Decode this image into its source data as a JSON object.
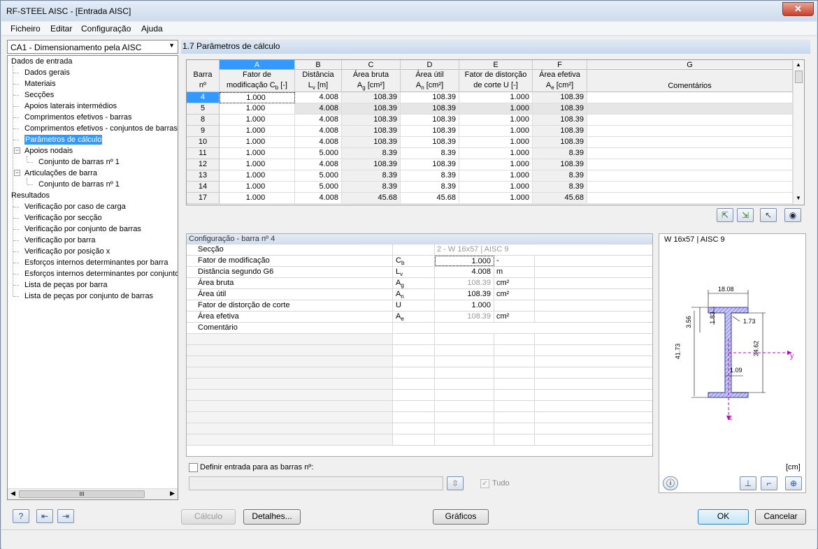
{
  "window": {
    "title": "RF-STEEL AISC - [Entrada AISC]",
    "close": "✕"
  },
  "menu": [
    "Ficheiro",
    "Editar",
    "Configuração",
    "Ajuda"
  ],
  "case_select": "CA1 - Dimensionamento pela AISC",
  "tree": {
    "input_root": "Dados de entrada",
    "input_items": [
      "Dados gerais",
      "Materiais",
      "Secções",
      "Apoios laterais intermédios",
      "Comprimentos efetivos - barras",
      "Comprimentos efetivos - conjuntos de barras",
      "Parâmetros de cálculo",
      "Apoios nodais",
      "Conjunto de barras nº 1",
      "Articulações de barra",
      "Conjunto de barras nº 1"
    ],
    "results_root": "Resultados",
    "results_items": [
      "Verificação por caso de carga",
      "Verificação por secção",
      "Verificação por conjunto de barras",
      "Verificação por barra",
      "Verificação por posição x",
      "Esforços internos determinantes por barra",
      "Esforços internos determinantes por conjunto",
      "Lista de peças por barra",
      "Lista de peças por conjunto de barras"
    ]
  },
  "panel_title": "1.7 Parâmetros de cálculo",
  "grid": {
    "col_letters": [
      "A",
      "B",
      "C",
      "D",
      "E",
      "F",
      "G"
    ],
    "row_header": {
      "l1": "Barra",
      "l2": "nº"
    },
    "headers": [
      {
        "l1": "Fator de",
        "l2": "modificação C",
        "sub": "b",
        "tail": " [-]"
      },
      {
        "l1": "Distância",
        "l2": "L",
        "sub": "v",
        "tail": " [m]"
      },
      {
        "l1": "Área bruta",
        "l2": "A",
        "sub": "g",
        "tail": " [cm²]"
      },
      {
        "l1": "Área útil",
        "l2": "A",
        "sub": "n",
        "tail": " [cm²]"
      },
      {
        "l1": "Fator de distorção",
        "l2": "de corte U",
        "sub": "",
        "tail": " [-]"
      },
      {
        "l1": "Área efetiva",
        "l2": "A",
        "sub": "e",
        "tail": " [cm²]"
      },
      {
        "l1": "",
        "l2": "Comentários",
        "sub": "",
        "tail": ""
      }
    ],
    "rows": [
      {
        "n": "4",
        "a": "1.000",
        "b": "4.008",
        "c": "108.39",
        "d": "108.39",
        "e": "1.000",
        "f": "108.39"
      },
      {
        "n": "5",
        "a": "1.000",
        "b": "4.008",
        "c": "108.39",
        "d": "108.39",
        "e": "1.000",
        "f": "108.39"
      },
      {
        "n": "8",
        "a": "1.000",
        "b": "4.008",
        "c": "108.39",
        "d": "108.39",
        "e": "1.000",
        "f": "108.39"
      },
      {
        "n": "9",
        "a": "1.000",
        "b": "4.008",
        "c": "108.39",
        "d": "108.39",
        "e": "1.000",
        "f": "108.39"
      },
      {
        "n": "10",
        "a": "1.000",
        "b": "4.008",
        "c": "108.39",
        "d": "108.39",
        "e": "1.000",
        "f": "108.39"
      },
      {
        "n": "11",
        "a": "1.000",
        "b": "5.000",
        "c": "8.39",
        "d": "8.39",
        "e": "1.000",
        "f": "8.39"
      },
      {
        "n": "12",
        "a": "1.000",
        "b": "4.008",
        "c": "108.39",
        "d": "108.39",
        "e": "1.000",
        "f": "108.39"
      },
      {
        "n": "13",
        "a": "1.000",
        "b": "5.000",
        "c": "8.39",
        "d": "8.39",
        "e": "1.000",
        "f": "8.39"
      },
      {
        "n": "14",
        "a": "1.000",
        "b": "5.000",
        "c": "8.39",
        "d": "8.39",
        "e": "1.000",
        "f": "8.39"
      },
      {
        "n": "17",
        "a": "1.000",
        "b": "4.008",
        "c": "45.68",
        "d": "45.68",
        "e": "1.000",
        "f": "45.68"
      }
    ]
  },
  "config": {
    "title": "Configuração - barra nº 4",
    "rows": [
      {
        "label": "Secção",
        "sym": "",
        "sub": "",
        "val": "2 - W 16x57 | AISC 9",
        "unit": ""
      },
      {
        "label": "Fator de modificação",
        "sym": "C",
        "sub": "b",
        "val": "1.000",
        "unit": "-"
      },
      {
        "label": "Distância segundo G6",
        "sym": "L",
        "sub": "v",
        "val": "4.008",
        "unit": "m"
      },
      {
        "label": "Área bruta",
        "sym": "A",
        "sub": "g",
        "val": "108.39",
        "unit": "cm²"
      },
      {
        "label": "Área útil",
        "sym": "A",
        "sub": "n",
        "val": "108.39",
        "unit": "cm²"
      },
      {
        "label": "Fator de distorção de corte",
        "sym": "U",
        "sub": "",
        "val": "1.000",
        "unit": ""
      },
      {
        "label": "Área efetiva",
        "sym": "A",
        "sub": "e",
        "val": "108.39",
        "unit": "cm²"
      },
      {
        "label": "Comentário",
        "sym": "",
        "sub": "",
        "val": "",
        "unit": ""
      }
    ],
    "set_for_label": "Definir entrada para as barras nº:",
    "all_label": "Tudo"
  },
  "section_view": {
    "title": "W 16x57 | AISC 9",
    "unit": "[cm]",
    "dims": {
      "b": "18.08",
      "tf": "1.83",
      "k": "3.56",
      "r": "1.73",
      "h": "41.73",
      "hw": "34.62",
      "tw": "1.09"
    },
    "axis_y": "y",
    "axis_z": "z"
  },
  "buttons": {
    "calc": "Cálculo",
    "details": "Detalhes...",
    "graphics": "Gráficos",
    "ok": "OK",
    "cancel": "Cancelar"
  }
}
